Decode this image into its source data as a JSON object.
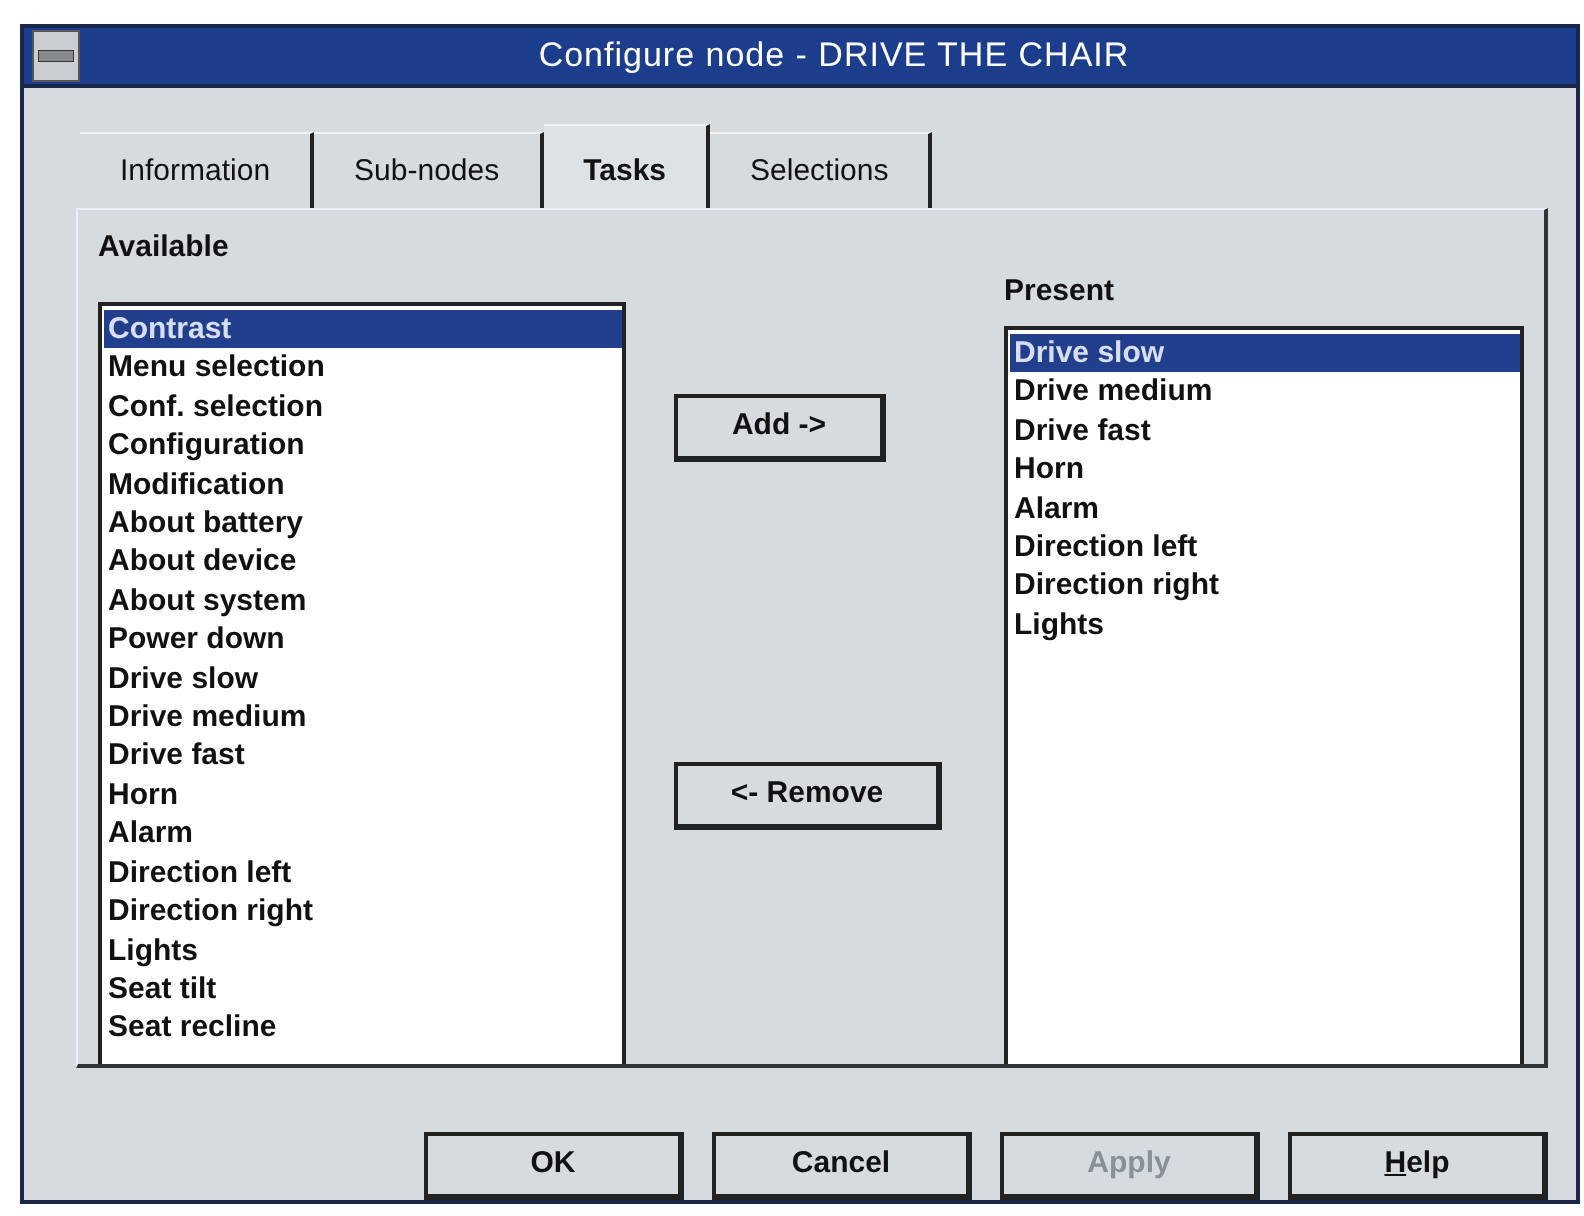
{
  "window": {
    "title": "Configure node - DRIVE THE CHAIR"
  },
  "tabs": [
    {
      "label": "Information",
      "selected": false
    },
    {
      "label": "Sub-nodes",
      "selected": false
    },
    {
      "label": "Tasks",
      "selected": true
    },
    {
      "label": "Selections",
      "selected": false
    }
  ],
  "available": {
    "label": "Available",
    "items": [
      {
        "label": "Contrast",
        "selected": true
      },
      {
        "label": "Menu selection",
        "selected": false
      },
      {
        "label": "Conf. selection",
        "selected": false
      },
      {
        "label": "Configuration",
        "selected": false
      },
      {
        "label": "Modification",
        "selected": false
      },
      {
        "label": "About battery",
        "selected": false
      },
      {
        "label": "About device",
        "selected": false
      },
      {
        "label": "About system",
        "selected": false
      },
      {
        "label": "Power down",
        "selected": false
      },
      {
        "label": "Drive slow",
        "selected": false
      },
      {
        "label": "Drive medium",
        "selected": false
      },
      {
        "label": "Drive fast",
        "selected": false
      },
      {
        "label": "Horn",
        "selected": false
      },
      {
        "label": "Alarm",
        "selected": false
      },
      {
        "label": "Direction left",
        "selected": false
      },
      {
        "label": "Direction right",
        "selected": false
      },
      {
        "label": "Lights",
        "selected": false
      },
      {
        "label": "Seat tilt",
        "selected": false
      },
      {
        "label": "Seat recline",
        "selected": false
      }
    ]
  },
  "transfer_buttons": [
    {
      "label": "Add ->"
    },
    {
      "label": "<- Remove"
    }
  ],
  "present": {
    "label": "Present",
    "items": [
      {
        "label": "Drive slow",
        "selected": true
      },
      {
        "label": "Drive medium",
        "selected": false
      },
      {
        "label": "Drive fast",
        "selected": false
      },
      {
        "label": "Horn",
        "selected": false
      },
      {
        "label": "Alarm",
        "selected": false
      },
      {
        "label": "Direction left",
        "selected": false
      },
      {
        "label": "Direction right",
        "selected": false
      },
      {
        "label": "Lights",
        "selected": false
      }
    ]
  },
  "buttons": [
    {
      "label": "OK",
      "disabled": false,
      "mnemonic": false
    },
    {
      "label": "Cancel",
      "disabled": false,
      "mnemonic": false
    },
    {
      "label": "Apply",
      "disabled": true,
      "mnemonic": false
    },
    {
      "label": "Help",
      "disabled": false,
      "mnemonic": true
    }
  ]
}
